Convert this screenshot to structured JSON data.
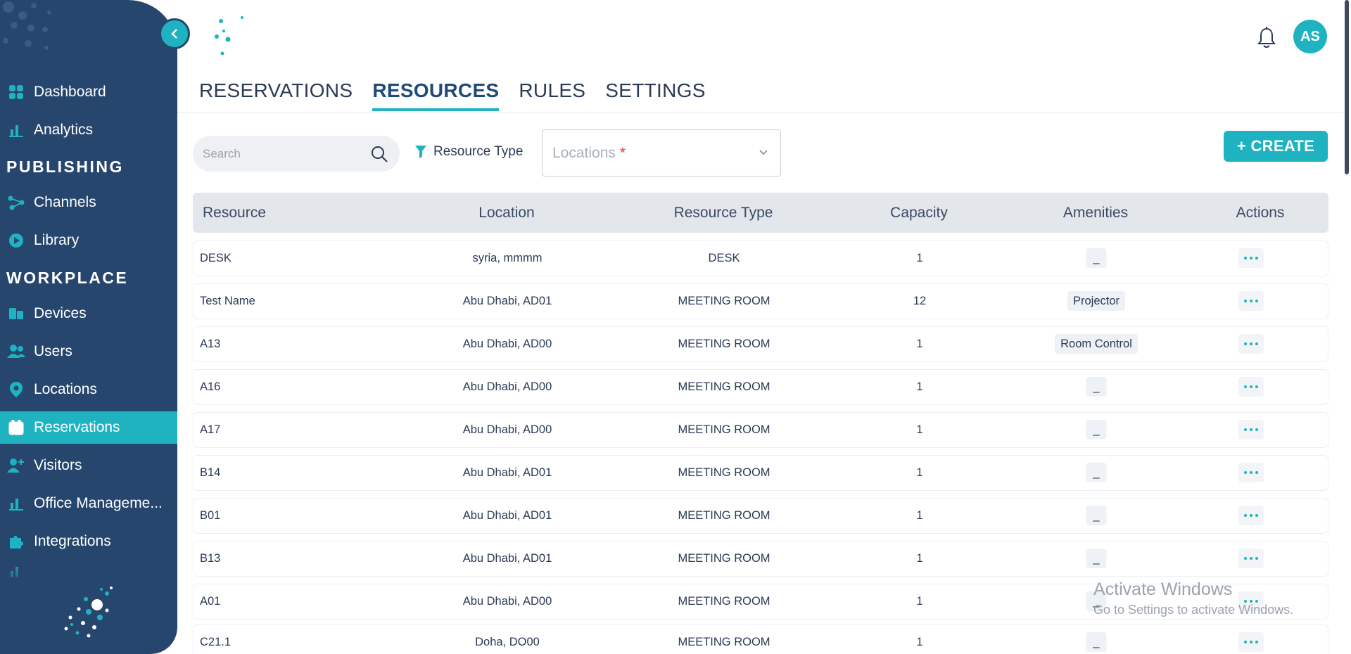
{
  "sidebar": {
    "items": [
      {
        "label": "Dashboard",
        "icon": "grid-icon"
      },
      {
        "label": "Analytics",
        "icon": "bar-chart-icon"
      },
      {
        "label": "Channels",
        "icon": "share-icon"
      },
      {
        "label": "Library",
        "icon": "play-circle-icon"
      },
      {
        "label": "Devices",
        "icon": "devices-icon"
      },
      {
        "label": "Users",
        "icon": "users-icon"
      },
      {
        "label": "Locations",
        "icon": "map-pin-icon"
      },
      {
        "label": "Reservations",
        "icon": "calendar-icon",
        "active": true
      },
      {
        "label": "Visitors",
        "icon": "user-plus-icon"
      },
      {
        "label": "Office Manageme...",
        "icon": "bar-chart-icon"
      },
      {
        "label": "Integrations",
        "icon": "puzzle-icon"
      }
    ],
    "sections": {
      "publishing": "PUBLISHING",
      "workplace": "WORKPLACE"
    },
    "colors": {
      "background": "#26466e",
      "active": "#1fb3c2"
    }
  },
  "header": {
    "avatar_initials": "AS"
  },
  "tabs": [
    {
      "label": "RESERVATIONS",
      "active": false
    },
    {
      "label": "RESOURCES",
      "active": true
    },
    {
      "label": "RULES",
      "active": false
    },
    {
      "label": "SETTINGS",
      "active": false
    }
  ],
  "toolbar": {
    "search_placeholder": "Search",
    "filter_label": "Resource Type",
    "locations_placeholder": "Locations",
    "locations_required": "*",
    "create_label": "+ CREATE"
  },
  "table": {
    "columns": [
      "Resource",
      "Location",
      "Resource Type",
      "Capacity",
      "Amenities",
      "Actions"
    ],
    "rows": [
      {
        "resource": "DESK",
        "location": "syria, mmmm",
        "type": "DESK",
        "capacity": "1",
        "amenities": "_"
      },
      {
        "resource": "Test Name",
        "location": "Abu Dhabi, AD01",
        "type": "MEETING ROOM",
        "capacity": "12",
        "amenities": "Projector"
      },
      {
        "resource": "A13",
        "location": "Abu Dhabi, AD00",
        "type": "MEETING ROOM",
        "capacity": "1",
        "amenities": "Room Control"
      },
      {
        "resource": "A16",
        "location": "Abu Dhabi, AD00",
        "type": "MEETING ROOM",
        "capacity": "1",
        "amenities": "_"
      },
      {
        "resource": "A17",
        "location": "Abu Dhabi, AD00",
        "type": "MEETING ROOM",
        "capacity": "1",
        "amenities": "_"
      },
      {
        "resource": "B14",
        "location": "Abu Dhabi, AD01",
        "type": "MEETING ROOM",
        "capacity": "1",
        "amenities": "_"
      },
      {
        "resource": "B01",
        "location": "Abu Dhabi, AD01",
        "type": "MEETING ROOM",
        "capacity": "1",
        "amenities": "_"
      },
      {
        "resource": "B13",
        "location": "Abu Dhabi, AD01",
        "type": "MEETING ROOM",
        "capacity": "1",
        "amenities": "_"
      },
      {
        "resource": "A01",
        "location": "Abu Dhabi, AD00",
        "type": "MEETING ROOM",
        "capacity": "1",
        "amenities": "_"
      },
      {
        "resource": "C21.1",
        "location": "Doha, DO00",
        "type": "MEETING ROOM",
        "capacity": "1",
        "amenities": "_"
      }
    ]
  },
  "watermark": {
    "line1": "Activate Windows",
    "line2": "Go to Settings to activate Windows."
  }
}
